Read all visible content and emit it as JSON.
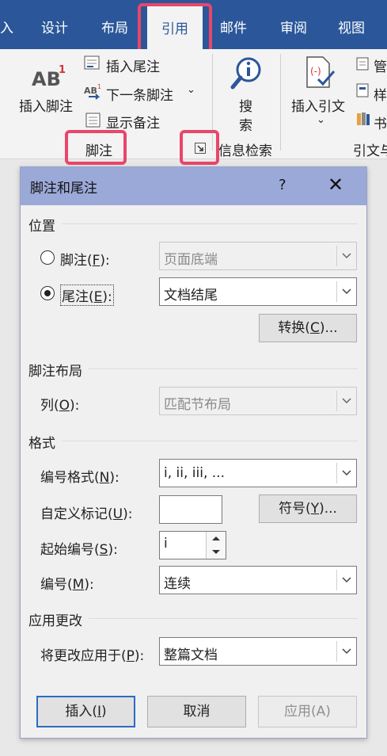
{
  "ribbon": {
    "tabs": [
      "入",
      "设计",
      "布局",
      "引用",
      "邮件",
      "审阅",
      "视图"
    ],
    "active_tab": "引用",
    "footnote_group": {
      "insert_footnote": "插入脚注",
      "insert_endnote": "插入尾注",
      "next_footnote": "下一条脚注",
      "show_notes": "显示备注",
      "group_label": "脚注"
    },
    "research_group": {
      "search_line1": "搜",
      "search_line2": "索",
      "group_label": "信息检索"
    },
    "citations_group": {
      "insert_citation": "插入引文",
      "manage_partial": "管",
      "style_partial": "样",
      "bib_partial": "书",
      "group_label": "引文与"
    }
  },
  "dialog": {
    "title": "脚注和尾注",
    "help": "?",
    "close": "✕",
    "location": {
      "section": "位置",
      "footnote_label": "脚注(",
      "footnote_key": "F",
      "footnote_tail": "):",
      "footnote_value": "页面底端",
      "endnote_label": "尾注(",
      "endnote_key": "E",
      "endnote_tail": "):",
      "endnote_value": "文档结尾",
      "selected": "endnote",
      "convert_btn": "转换(",
      "convert_key": "C",
      "convert_tail": ")..."
    },
    "layout": {
      "section": "脚注布局",
      "columns_label": "列(",
      "columns_key": "O",
      "columns_tail": "):",
      "columns_value": "匹配节布局"
    },
    "format": {
      "section": "格式",
      "number_format_label": "编号格式(",
      "number_format_key": "N",
      "number_format_tail": "):",
      "number_format_value": "i, ii, iii, ...",
      "custom_mark_label": "自定义标记(",
      "custom_mark_key": "U",
      "custom_mark_tail": "):",
      "custom_mark_value": "",
      "symbol_btn": "符号(",
      "symbol_key": "Y",
      "symbol_tail": ")...",
      "start_at_label": "起始编号(",
      "start_at_key": "S",
      "start_at_tail": "):",
      "start_at_value": "i",
      "numbering_label": "编号(",
      "numbering_key": "M",
      "numbering_tail": "):",
      "numbering_value": "连续"
    },
    "apply": {
      "section": "应用更改",
      "apply_to_label": "将更改应用于(",
      "apply_to_key": "P",
      "apply_to_tail": "):",
      "apply_to_value": "整篇文档"
    },
    "buttons": {
      "insert": "插入(",
      "insert_key": "I",
      "insert_tail": ")",
      "cancel": "取消",
      "apply": "应用(A)"
    }
  },
  "colors": {
    "ribbon_blue": "#2b579a",
    "highlight_red": "#e8466a",
    "dialog_title": "#9ba9d8"
  }
}
